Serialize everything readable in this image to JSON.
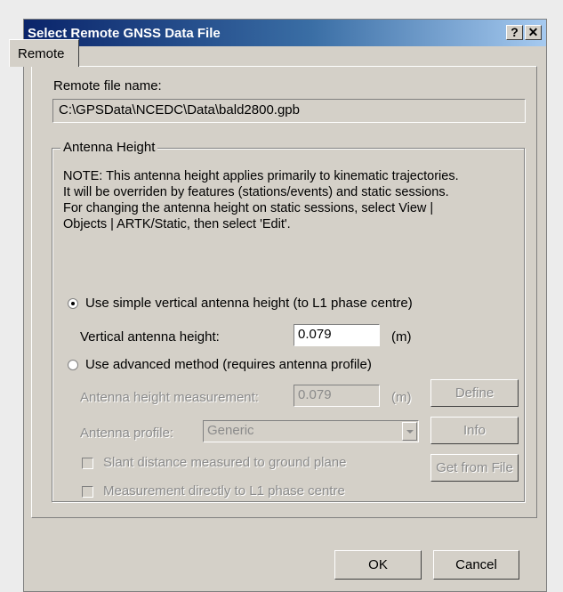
{
  "window": {
    "title": "Select Remote GNSS Data File",
    "help_label": "?",
    "close_label": "✕"
  },
  "tabs": [
    {
      "label": "Remote",
      "selected": true
    }
  ],
  "remote": {
    "file_name_label": "Remote file name:",
    "file_name_value": "C:\\GPSData\\NCEDC\\Data\\bald2800.gpb"
  },
  "antenna": {
    "group_label": "Antenna Height",
    "note_lines": [
      "NOTE: This antenna height applies primarily to kinematic trajectories.",
      "It will be overriden by features (stations/events) and static sessions.",
      "For changing the antenna height on static sessions, select View |",
      "Objects | ARTK/Static, then select 'Edit'."
    ],
    "simple_option_label": "Use simple vertical antenna height (to L1 phase centre)",
    "simple_selected": true,
    "vertical_height_label": "Vertical antenna height:",
    "vertical_height_value": "0.079",
    "vertical_height_unit": "(m)",
    "advanced_option_label": "Use advanced method (requires antenna profile)",
    "advanced_selected": false,
    "measurement_label": "Antenna height measurement:",
    "measurement_value": "0.079",
    "measurement_unit": "(m)",
    "define_button": "Define",
    "profile_label": "Antenna profile:",
    "profile_value": "Generic",
    "info_button": "Info",
    "get_from_file_button": "Get from File",
    "slant_label": "Slant distance measured to ground plane",
    "direct_label": "Measurement directly to L1 phase centre"
  },
  "footer": {
    "ok_button": "OK",
    "cancel_button": "Cancel"
  }
}
